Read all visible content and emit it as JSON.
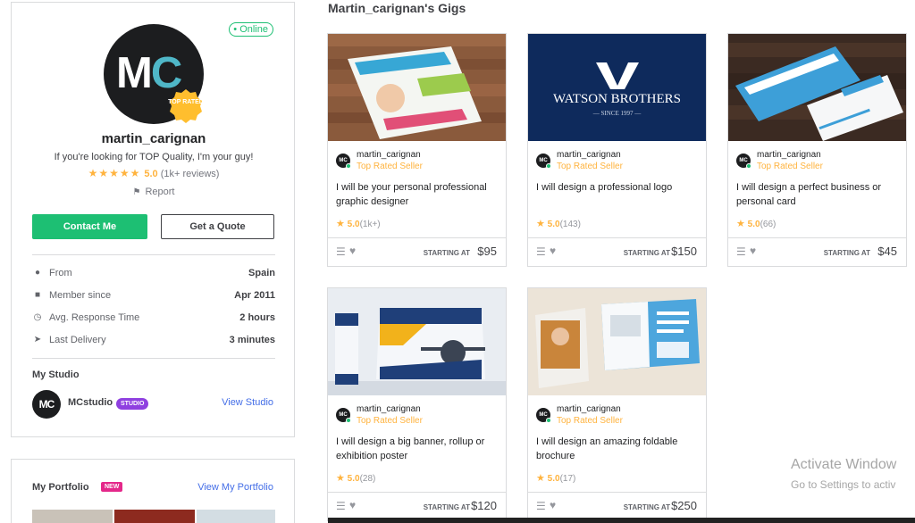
{
  "profile": {
    "status": "• Online",
    "avatar_initials": {
      "first": "M",
      "second": "C"
    },
    "badge": "TOP RATED",
    "username": "martin_carignan",
    "tagline": "If you're looking for TOP Quality, I'm your guy!",
    "stars": "★★★★★",
    "rating": "5.0",
    "reviews": "(1k+ reviews)",
    "report": "Report",
    "contact_label": "Contact Me",
    "quote_label": "Get a Quote",
    "stats": [
      {
        "icon": "location-pin-icon",
        "label": "From",
        "value": "Spain"
      },
      {
        "icon": "user-icon",
        "label": "Member since",
        "value": "Apr 2011"
      },
      {
        "icon": "clock-icon",
        "label": "Avg. Response Time",
        "value": "2 hours"
      },
      {
        "icon": "paper-plane-icon",
        "label": "Last Delivery",
        "value": "3 minutes"
      }
    ],
    "studio": {
      "title": "My Studio",
      "avatar": "MC",
      "name": "MCstudio",
      "tag": "STUDIO",
      "link": "View Studio"
    }
  },
  "portfolio": {
    "title": "My Portfolio",
    "badge": "NEW",
    "link": "View My Portfolio"
  },
  "gigs_section": {
    "title": "Martin_carignan's Gigs",
    "gigs": [
      {
        "thumbnail": "flyer-mockup",
        "seller": "martin_carignan",
        "level": "Top Rated Seller",
        "title": "I will be your personal professional graphic designer",
        "rating": "5.0",
        "count": "(1k+)",
        "starting": "STARTING AT",
        "price": "$95"
      },
      {
        "thumbnail": "watson-brothers-logo",
        "thumb_text": "WATSON BROTHERS",
        "thumb_sub": "— SINCE 1997 —",
        "seller": "martin_carignan",
        "level": "Top Rated Seller",
        "title": "I will design a professional logo",
        "rating": "5.0",
        "count": "(143)",
        "starting": "STARTING AT",
        "price": "$150"
      },
      {
        "thumbnail": "business-cards",
        "seller": "martin_carignan",
        "level": "Top Rated Seller",
        "title": "I will design a perfect business or personal card",
        "rating": "5.0",
        "count": "(66)",
        "starting": "STARTING AT",
        "price": "$45"
      },
      {
        "thumbnail": "banner-rollup",
        "seller": "martin_carignan",
        "level": "Top Rated Seller",
        "title": "I will design a big banner, rollup or exhibition poster",
        "rating": "5.0",
        "count": "(28)",
        "starting": "STARTING AT",
        "price": "$120"
      },
      {
        "thumbnail": "foldable-brochure",
        "seller": "martin_carignan",
        "level": "Top Rated Seller",
        "title": "I will design an amazing foldable brochure",
        "rating": "5.0",
        "count": "(17)",
        "starting": "STARTING AT",
        "price": "$250"
      }
    ]
  },
  "watermark": {
    "title": "Activate Window",
    "subtitle": "Go to Settings to activ"
  },
  "colors": {
    "accent": "#1dbf73",
    "star": "#ffb33e",
    "link": "#446ee7",
    "studio_tag": "#8f40e0",
    "new_badge": "#e4288a"
  }
}
